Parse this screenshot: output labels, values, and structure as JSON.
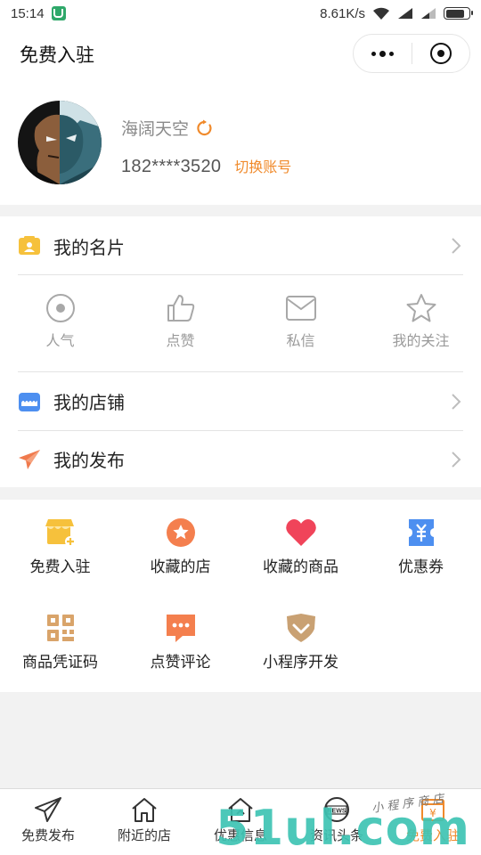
{
  "status_bar": {
    "time": "15:14",
    "net_speed": "8.61K/s",
    "icons": [
      "shield-icon",
      "wifi-icon",
      "signal-icon",
      "signal-icon",
      "battery-icon"
    ],
    "battery_level": 0.8
  },
  "nav": {
    "title": "免费入驻",
    "capsule_icons": [
      "more-dots-icon",
      "close-target-icon"
    ]
  },
  "profile": {
    "nickname": "海阔天空",
    "phone": "182****3520",
    "switch_account": "切换账号",
    "icons": [
      "avatar",
      "refresh-icon"
    ]
  },
  "menu": {
    "my_card": {
      "label": "我的名片",
      "icon": "id-card-icon",
      "color": "#f6c13c"
    },
    "stats": [
      {
        "label": "人气",
        "icon": "eye-circle-icon"
      },
      {
        "label": "点赞",
        "icon": "thumbs-up-icon"
      },
      {
        "label": "私信",
        "icon": "mail-icon"
      },
      {
        "label": "我的关注",
        "icon": "star-icon"
      }
    ],
    "my_store": {
      "label": "我的店铺",
      "icon": "store-icon",
      "color": "#4d8ff0"
    },
    "my_posts": {
      "label": "我的发布",
      "icon": "paper-plane-icon",
      "color": "#f07a4d"
    }
  },
  "grid": [
    {
      "label": "免费入驻",
      "icon": "shop-add-icon",
      "color": "#f6c13c"
    },
    {
      "label": "收藏的店",
      "icon": "star-badge-icon",
      "color": "#f47f4e"
    },
    {
      "label": "收藏的商品",
      "icon": "heart-icon",
      "color": "#f0445a"
    },
    {
      "label": "优惠券",
      "icon": "coupon-icon",
      "color": "#4d8ff0"
    },
    {
      "label": "商品凭证码",
      "icon": "qr-code-icon",
      "color": "#d9a46a"
    },
    {
      "label": "点赞评论",
      "icon": "comment-icon",
      "color": "#f47f4e"
    },
    {
      "label": "小程序开发",
      "icon": "diamond-check-icon",
      "color": "#c9a173"
    }
  ],
  "tabbar": [
    {
      "label": "免费发布",
      "icon": "send-icon"
    },
    {
      "label": "附近的店",
      "icon": "home-icon"
    },
    {
      "label": "优惠信息",
      "icon": "home-up-icon"
    },
    {
      "label": "资讯头条",
      "icon": "news-icon",
      "badge": "NEWS"
    },
    {
      "label": "免费入驻",
      "icon": "yuan-shop-icon",
      "badge": "¥",
      "active": true
    }
  ],
  "watermark": {
    "big": "51ul.com",
    "small": "小 程 序 商 店"
  },
  "colors": {
    "accent_orange": "#f08a2b",
    "watermark_teal": "#3ec3b3",
    "watermark_orange": "#f7a21b"
  }
}
